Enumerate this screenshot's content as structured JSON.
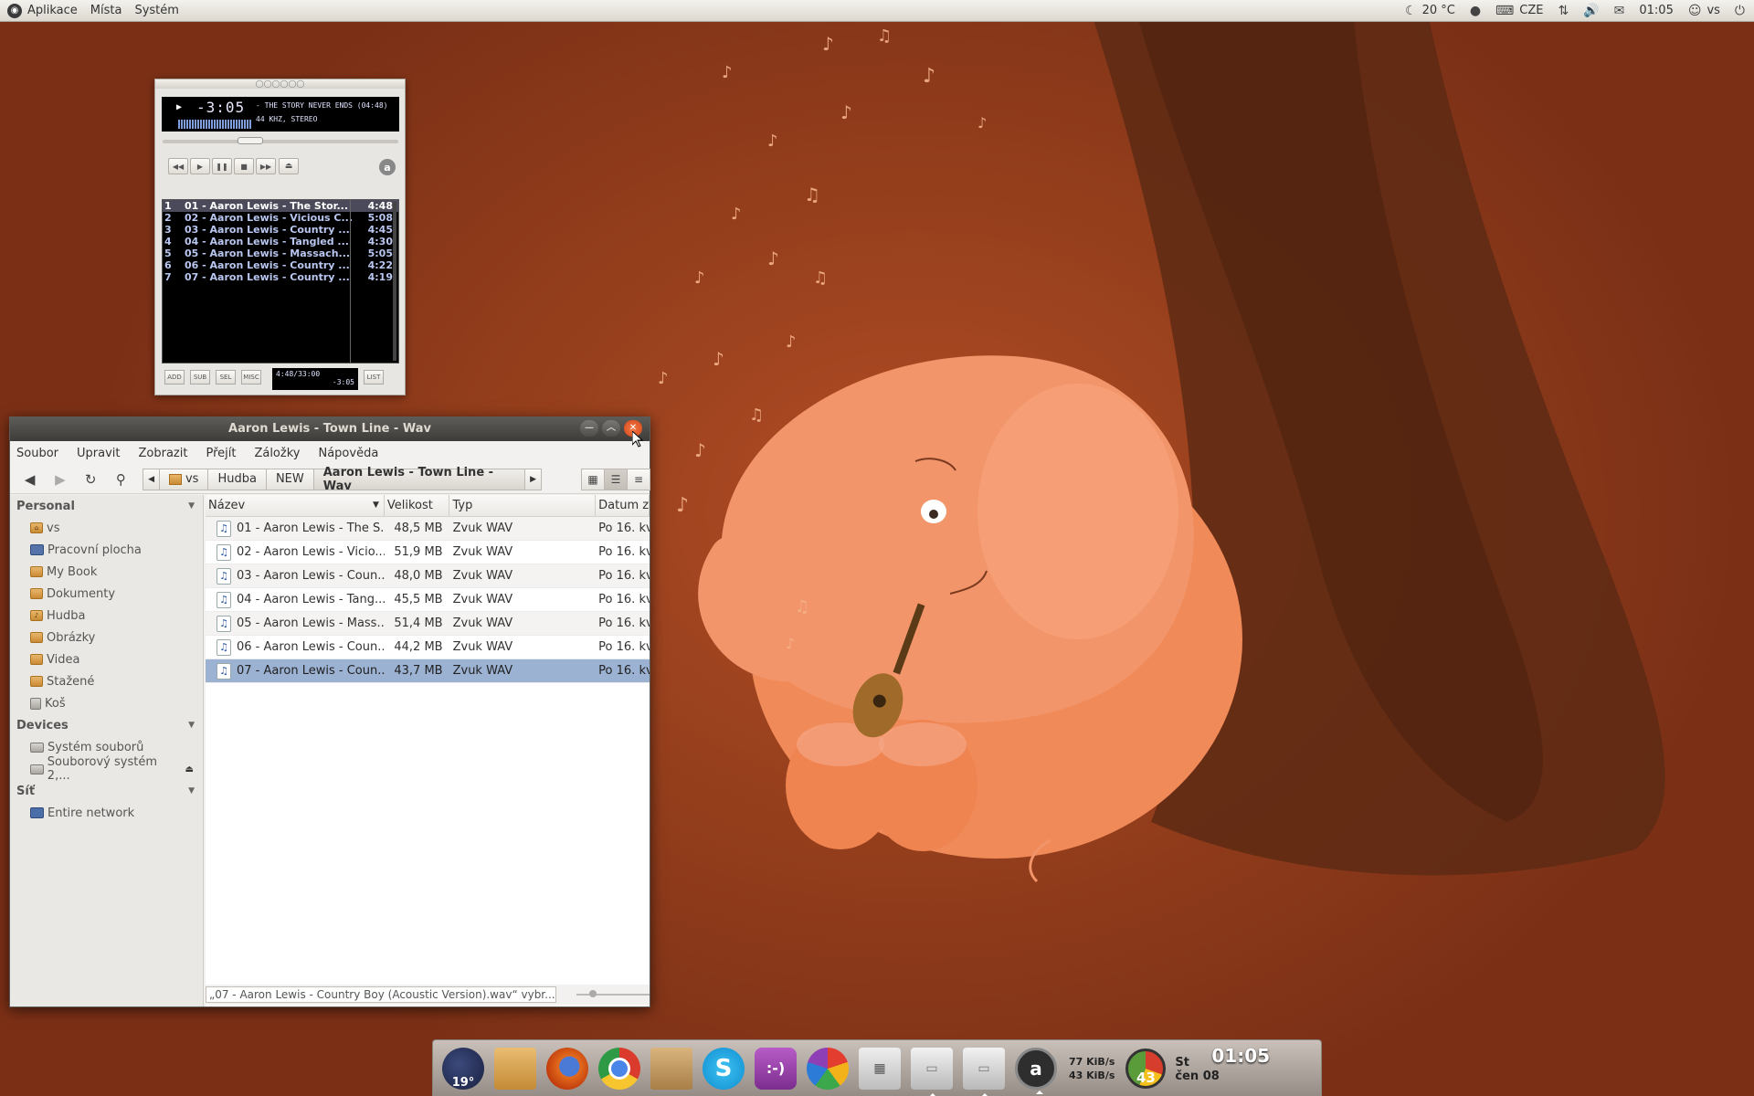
{
  "top_panel": {
    "menus": [
      "Aplikace",
      "Místa",
      "Systém"
    ],
    "temperature": "20 °C",
    "keyboard": "CZE",
    "time": "01:05",
    "user": "vs"
  },
  "player": {
    "time": "-3:05",
    "track_info": "- THE STORY NEVER ENDS (04:48)",
    "format": "44 KHZ, STEREO",
    "playlist": [
      {
        "num": "1",
        "name": "01 - Aaron Lewis - The Stor...",
        "dur": "4:48"
      },
      {
        "num": "2",
        "name": "02 - Aaron Lewis - Vicious C...",
        "dur": "5:08"
      },
      {
        "num": "3",
        "name": "03 - Aaron Lewis - Country ...",
        "dur": "4:45"
      },
      {
        "num": "4",
        "name": "04 - Aaron Lewis - Tangled ...",
        "dur": "4:30"
      },
      {
        "num": "5",
        "name": "05 - Aaron Lewis - Massach...",
        "dur": "5:05"
      },
      {
        "num": "6",
        "name": "06 - Aaron Lewis - Country ...",
        "dur": "4:22"
      },
      {
        "num": "7",
        "name": "07 - Aaron Lewis - Country ...",
        "dur": "4:19"
      }
    ],
    "pl_buttons": [
      "ADD",
      "SUB",
      "SEL",
      "MISC"
    ],
    "pl_time": "4:48/33:00",
    "pl_remaining": "-3:05",
    "list_button": "LIST"
  },
  "nautilus": {
    "title": "Aaron Lewis - Town Line - Wav",
    "menus": [
      "Soubor",
      "Upravit",
      "Zobrazit",
      "Přejít",
      "Záložky",
      "Nápověda"
    ],
    "breadcrumbs": [
      "vs",
      "Hudba",
      "NEW",
      "Aaron Lewis - Town Line - Wav"
    ],
    "sidebar": {
      "personal_header": "Personal",
      "personal": [
        "vs",
        "Pracovní plocha",
        "My Book",
        "Dokumenty",
        "Hudba",
        "Obrázky",
        "Videa",
        "Stažené",
        "Koš"
      ],
      "devices_header": "Devices",
      "devices": [
        "Systém souborů",
        "Souborový systém 2,..."
      ],
      "network_header": "Síť",
      "network": [
        "Entire network"
      ]
    },
    "columns": [
      "Název",
      "Velikost",
      "Typ",
      "Datum zm"
    ],
    "files": [
      {
        "name": "01 - Aaron Lewis - The S...",
        "size": "48,5 MB",
        "type": "Zvuk WAV",
        "date": "Po 16. kv"
      },
      {
        "name": "02 - Aaron Lewis - Vicio...",
        "size": "51,9 MB",
        "type": "Zvuk WAV",
        "date": "Po 16. kv"
      },
      {
        "name": "03 - Aaron Lewis - Coun...",
        "size": "48,0 MB",
        "type": "Zvuk WAV",
        "date": "Po 16. kv"
      },
      {
        "name": "04 - Aaron Lewis - Tang...",
        "size": "45,5 MB",
        "type": "Zvuk WAV",
        "date": "Po 16. kv"
      },
      {
        "name": "05 - Aaron Lewis - Mass...",
        "size": "51,4 MB",
        "type": "Zvuk WAV",
        "date": "Po 16. kv"
      },
      {
        "name": "06 - Aaron Lewis - Coun...",
        "size": "44,2 MB",
        "type": "Zvuk WAV",
        "date": "Po 16. kv"
      },
      {
        "name": "07 - Aaron Lewis - Coun...",
        "size": "43,7 MB",
        "type": "Zvuk WAV",
        "date": "Po 16. kv"
      }
    ],
    "status": "„07 - Aaron Lewis - Country Boy (Acoustic Version).wav“ vybr..."
  },
  "dock": {
    "weather_temp": "19°",
    "net_down": "77 KiB/s",
    "net_up": "43 KiB/s",
    "cpu": "43",
    "day": "St",
    "date": "čen 08",
    "time": "01:05"
  }
}
